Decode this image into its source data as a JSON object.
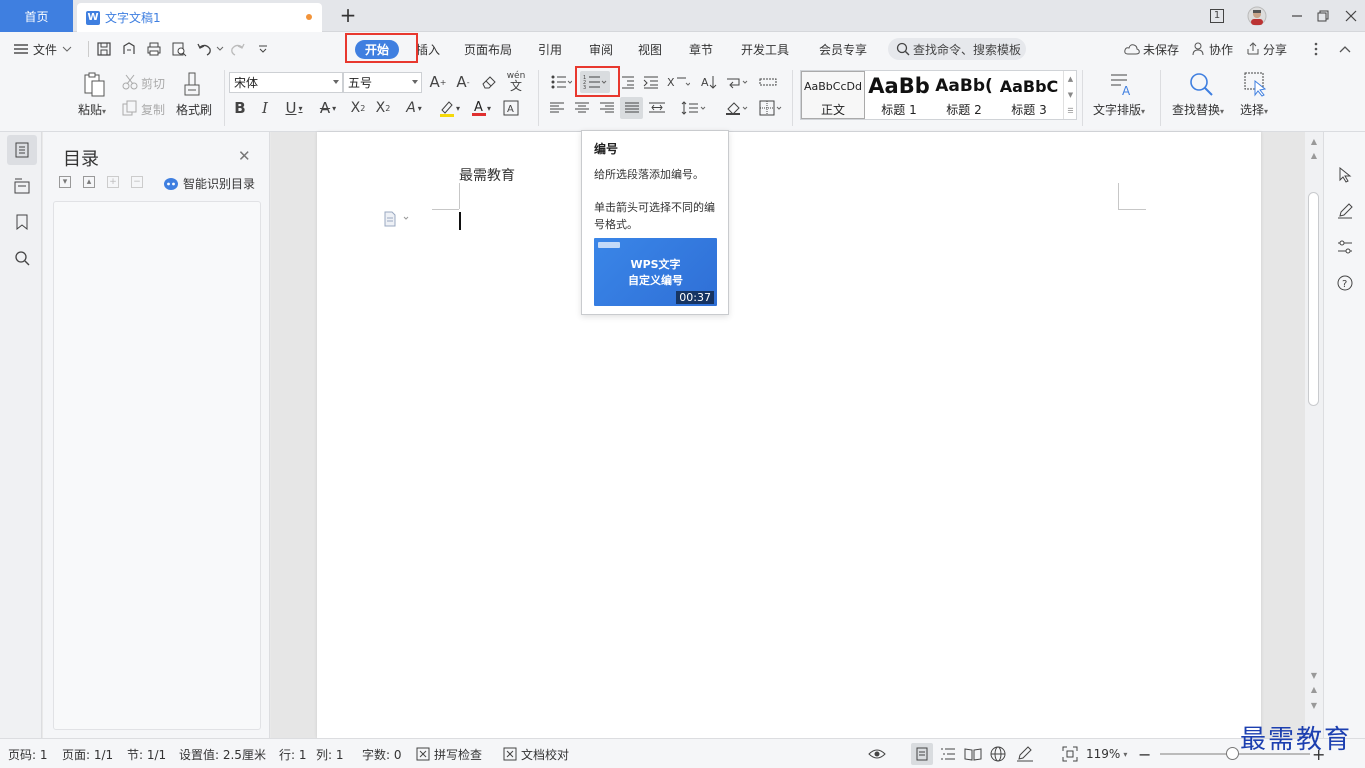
{
  "titlebar": {
    "home_tab": "首页",
    "doc_tab": "文字文稿1",
    "page_indicator": "1"
  },
  "menubar": {
    "file": "文件",
    "tabs": [
      "开始",
      "插入",
      "页面布局",
      "引用",
      "审阅",
      "视图",
      "章节",
      "开发工具",
      "会员专享"
    ],
    "search_placeholder": "查找命令、搜索模板",
    "unsaved": "未保存",
    "collab": "协作",
    "share": "分享"
  },
  "ribbon": {
    "paste": "粘贴",
    "cut": "剪切",
    "copy": "复制",
    "format_painter": "格式刷",
    "font_name": "宋体",
    "font_size": "五号",
    "styles": [
      {
        "preview": "AaBbCcDd",
        "name": "正文"
      },
      {
        "preview": "AaBb",
        "name": "标题 1"
      },
      {
        "preview": "AaBb(",
        "name": "标题 2"
      },
      {
        "preview": "AaBbC",
        "name": "标题 3"
      }
    ],
    "text_layout": "文字排版",
    "find_replace": "查找替换",
    "select": "选择"
  },
  "toc": {
    "title": "目录",
    "smart": "智能识别目录"
  },
  "document": {
    "text": "最需教育"
  },
  "tooltip": {
    "title": "编号",
    "desc": "给所选段落添加编号。",
    "desc2": "单击箭头可选择不同的编号格式。",
    "video_line1": "WPS文字",
    "video_line2": "自定义编号",
    "video_duration": "00:37"
  },
  "statusbar": {
    "page_num": "页码: 1",
    "pages": "页面: 1/1",
    "section": "节: 1/1",
    "setting": "设置值: 2.5厘米",
    "row": "行: 1",
    "col": "列: 1",
    "words": "字数: 0",
    "spell": "拼写检查",
    "proof": "文档校对",
    "zoom": "119%"
  },
  "watermark": "最需教育",
  "colors": {
    "accent": "#3f7fe0",
    "highlight_box": "#e8382e"
  }
}
